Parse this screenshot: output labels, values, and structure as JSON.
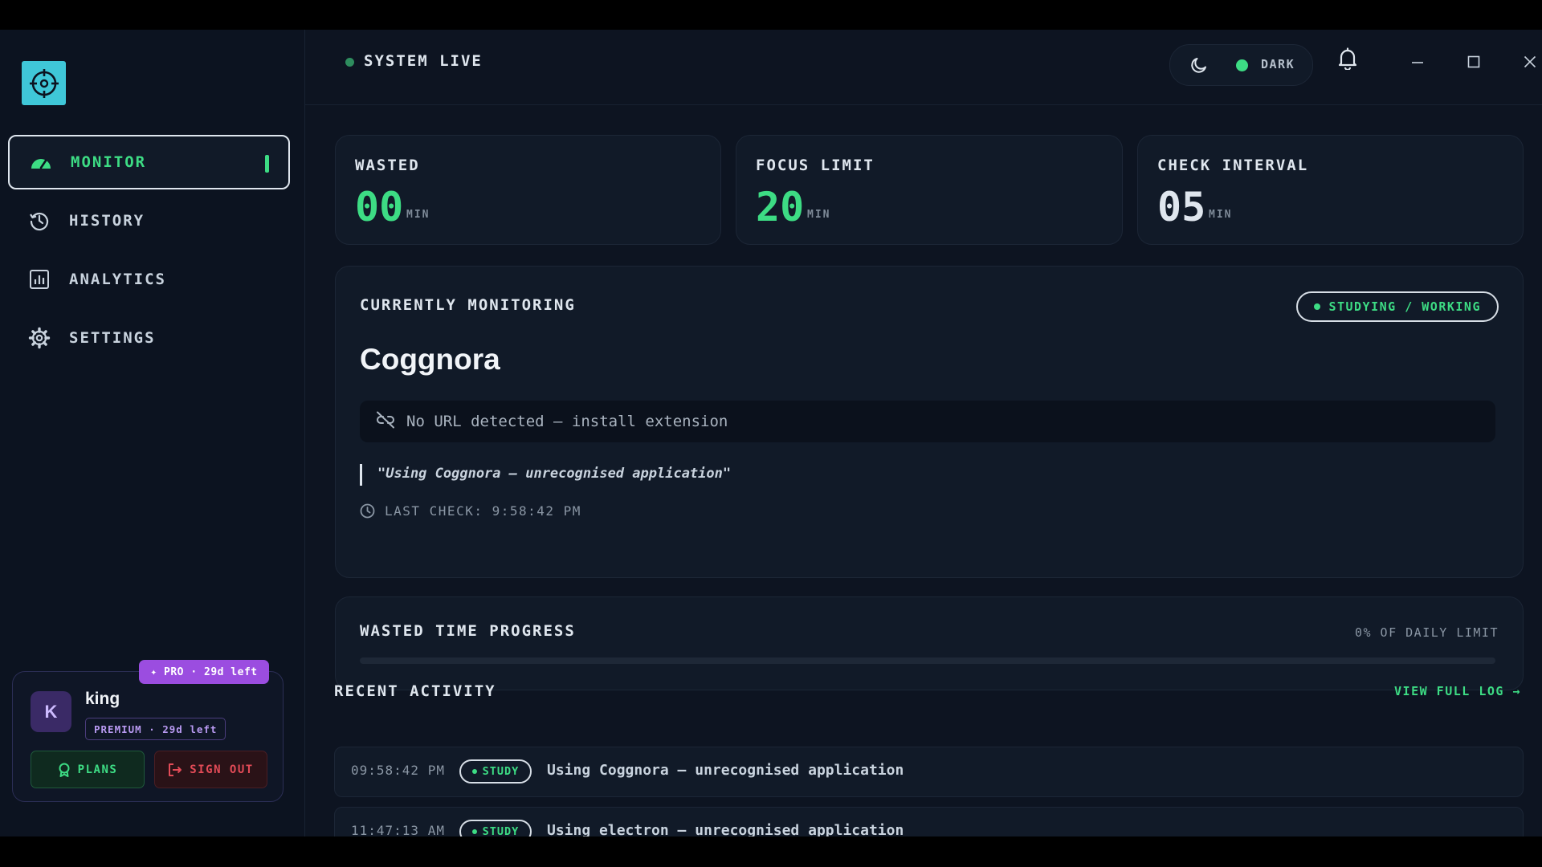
{
  "sidebar": {
    "items": [
      {
        "label": "MONITOR",
        "icon": "gauge-icon"
      },
      {
        "label": "HISTORY",
        "icon": "history-icon"
      },
      {
        "label": "ANALYTICS",
        "icon": "analytics-icon"
      },
      {
        "label": "SETTINGS",
        "icon": "gear-icon"
      }
    ],
    "active": "MONITOR"
  },
  "user": {
    "avatar_letter": "K",
    "name": "king",
    "pro_badge": "✦ PRO · 29d left",
    "tier": "PREMIUM · 29d left",
    "plans_label": "PLANS",
    "signout_label": "SIGN OUT"
  },
  "header": {
    "status": "SYSTEM LIVE",
    "theme_label": "DARK"
  },
  "stats": [
    {
      "label": "WASTED",
      "value": "00",
      "unit": "MIN"
    },
    {
      "label": "FOCUS LIMIT",
      "value": "20",
      "unit": "MIN"
    },
    {
      "label": "CHECK INTERVAL",
      "value": "05",
      "unit": "MIN"
    }
  ],
  "monitoring": {
    "title": "CURRENTLY MONITORING",
    "badge": "STUDYING / WORKING",
    "app_name": "Coggnora",
    "url_text": "No URL detected — install extension",
    "quote": "\"Using Coggnora — unrecognised application\"",
    "last_check": "LAST CHECK: 9:58:42 PM"
  },
  "progress": {
    "title": "WASTED TIME PROGRESS",
    "percent_label": "0% OF DAILY LIMIT",
    "fraction": 0
  },
  "activity": {
    "title": "RECENT ACTIVITY",
    "link": "VIEW FULL LOG →",
    "rows": [
      {
        "time": "09:58:42 PM",
        "tag": "STUDY",
        "desc": "Using Coggnora — unrecognised application"
      },
      {
        "time": "11:47:13 AM",
        "tag": "STUDY",
        "desc": "Using electron — unrecognised application"
      }
    ]
  },
  "colors": {
    "accent": "#3ddc84",
    "background": "#0d1421",
    "card": "#111a28",
    "pro": "#9b4de0",
    "danger": "#e34b57",
    "logo": "#3fc7d8"
  }
}
